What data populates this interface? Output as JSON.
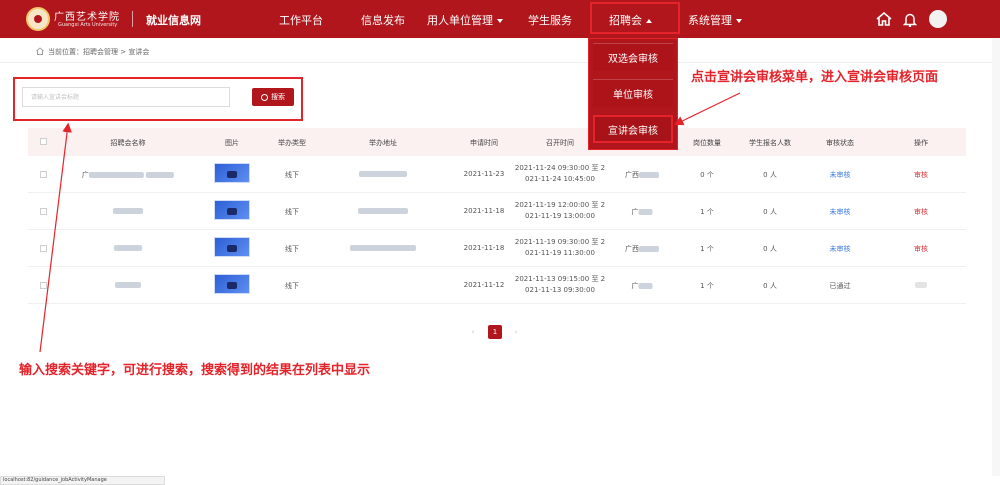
{
  "header": {
    "school_cn": "广西艺术学院",
    "school_en": "Guangxi Arts University",
    "site_name": "就业信息网",
    "nav": [
      {
        "label": "工作平台"
      },
      {
        "label": "信息发布"
      },
      {
        "label": "用人单位管理",
        "has_caret": true
      },
      {
        "label": "学生服务"
      },
      {
        "label": "招聘会",
        "has_caret": true,
        "active": true
      },
      {
        "label": "系统管理",
        "has_caret": true
      }
    ]
  },
  "dropdown": {
    "items": [
      {
        "label": "双选会审核"
      },
      {
        "label": "单位审核"
      },
      {
        "label": "宣讲会审核",
        "selected": true
      }
    ]
  },
  "breadcrumb": {
    "text": "当前位置：招聘会管理 > 宣讲会"
  },
  "search": {
    "placeholder": "请输入宣讲会标题",
    "button_label": "搜索"
  },
  "table": {
    "headers": [
      "招聘会名称",
      "图片",
      "举办类型",
      "举办地址",
      "申请时间",
      "召开时间",
      "岗位数量",
      "学生报名人数",
      "审核状态",
      "操作"
    ],
    "rows": [
      {
        "type": "线下",
        "apply_date": "2021-11-23",
        "time_line1": "2021-11-24 09:30:00 至 2",
        "time_line2": "021-11-24 10:45:00",
        "address_prefix": "广西",
        "positions": "0 个",
        "signups": "0 人",
        "status": "未审核",
        "status_kind": "pending",
        "operation": "审核",
        "name_prefix": "广"
      },
      {
        "type": "线下",
        "apply_date": "2021-11-18",
        "time_line1": "2021-11-19 12:00:00 至 2",
        "time_line2": "021-11-19 13:00:00",
        "address_prefix": "广",
        "positions": "1 个",
        "signups": "0 人",
        "status": "未审核",
        "status_kind": "pending",
        "operation": "审核",
        "name_prefix": ""
      },
      {
        "type": "线下",
        "apply_date": "2021-11-18",
        "time_line1": "2021-11-19 09:30:00 至 2",
        "time_line2": "021-11-19 11:30:00",
        "address_prefix": "广西",
        "positions": "1 个",
        "signups": "0 人",
        "status": "未审核",
        "status_kind": "pending",
        "operation": "审核",
        "name_prefix": ""
      },
      {
        "type": "线下",
        "apply_date": "2021-11-12",
        "time_line1": "2021-11-13 09:15:00 至 2",
        "time_line2": "021-11-13 09:30:00",
        "address_prefix": "广",
        "positions": "1 个",
        "signups": "0 人",
        "status": "已通过",
        "status_kind": "ok",
        "operation": "",
        "name_prefix": ""
      }
    ]
  },
  "pagination": {
    "prev": "‹",
    "current": "1",
    "next": "›"
  },
  "annotations": {
    "dropdown_note": "点击宣讲会审核菜单，进入宣讲会审核页面",
    "search_note": "输入搜索关键字，可进行搜索，搜索得到的结果在列表中显示"
  },
  "statusbar": {
    "url": "localhost:82/guidance_jobActivityManage"
  },
  "colors": {
    "brand_red": "#b0161b",
    "annotation_red": "#e4232a",
    "pending_blue": "#3a7be0"
  }
}
